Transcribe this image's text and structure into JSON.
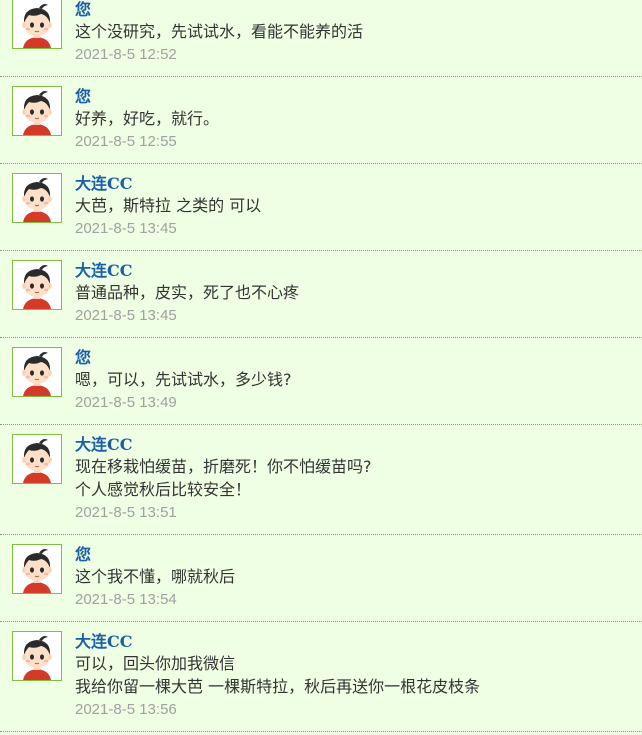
{
  "messages": [
    {
      "sender": "您",
      "lines": [
        "这个没研究，先试试水，看能不能养的活"
      ],
      "time": "2021-8-5 12:52"
    },
    {
      "sender": "您",
      "lines": [
        "好养，好吃，就行。"
      ],
      "time": "2021-8-5 12:55"
    },
    {
      "sender": "大连CC",
      "lines": [
        "大芭，斯特拉 之类的  可以"
      ],
      "time": "2021-8-5 13:45"
    },
    {
      "sender": "大连CC",
      "lines": [
        "普通品种，皮实，死了也不心疼"
      ],
      "time": "2021-8-5 13:45"
    },
    {
      "sender": "您",
      "lines": [
        "嗯，可以，先试试水，多少钱?"
      ],
      "time": "2021-8-5 13:49"
    },
    {
      "sender": "大连CC",
      "lines": [
        "现在移栽怕缓苗，折磨死！你不怕缓苗吗?",
        "个人感觉秋后比较安全！"
      ],
      "time": "2021-8-5 13:51"
    },
    {
      "sender": "您",
      "lines": [
        "这个我不懂，哪就秋后"
      ],
      "time": "2021-8-5 13:54"
    },
    {
      "sender": "大连CC",
      "lines": [
        "可以，回头你加我微信",
        "我给你留一棵大芭   一棵斯特拉，秋后再送你一根花皮枝条"
      ],
      "time": "2021-8-5 13:56"
    }
  ],
  "colors": {
    "background": "#eeffe4",
    "sender": "#1a5fa8",
    "text": "#333333",
    "time": "#a0a0a0",
    "avatar_border": "#7fbf3f"
  },
  "icons": {
    "avatar": "cartoon-boy-avatar-icon"
  }
}
